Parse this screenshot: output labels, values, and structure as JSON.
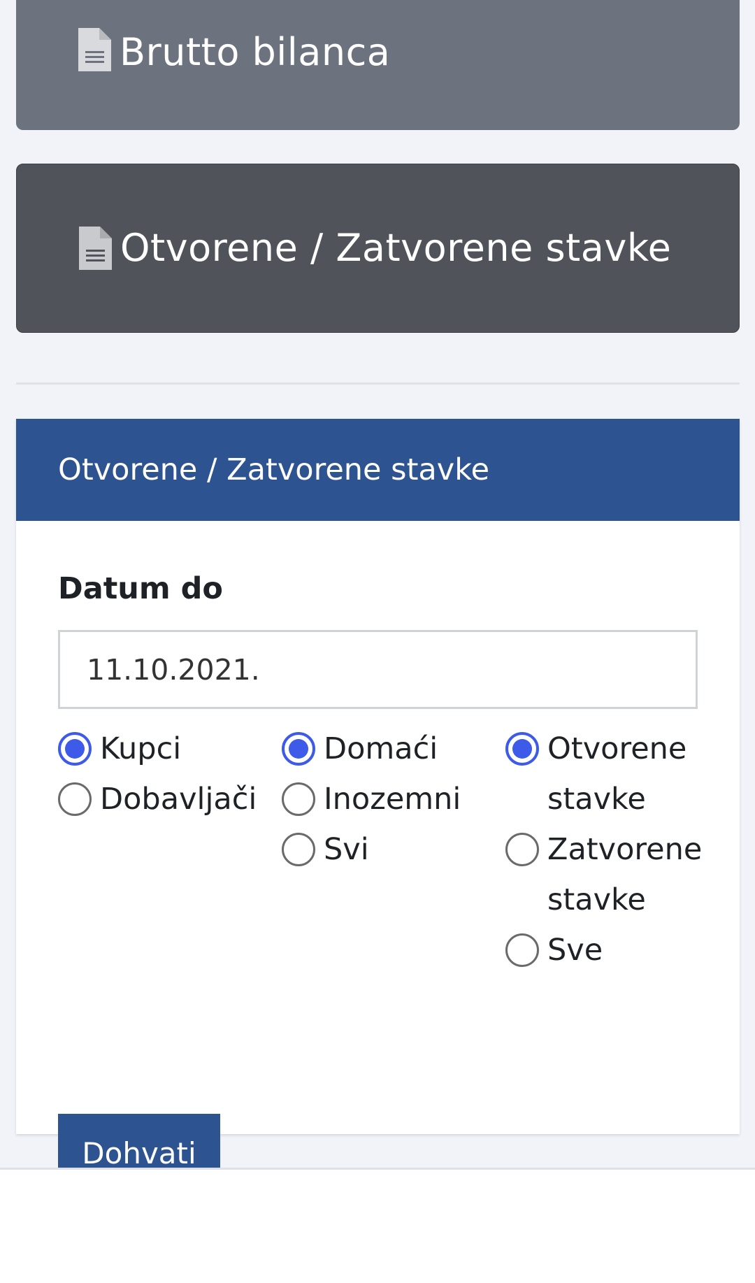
{
  "report_cards": [
    {
      "label": "Brutto bilanca",
      "icon": "document-icon"
    },
    {
      "label": "Otvorene / Zatvorene stavke",
      "icon": "document-icon"
    }
  ],
  "panel": {
    "title": "Otvorene / Zatvorene stavke",
    "date_label": "Datum do",
    "date_value": "11.10.2021.",
    "groups": [
      {
        "options": [
          {
            "label": "Kupci",
            "checked": true
          },
          {
            "label": "Dobavljači",
            "checked": false
          }
        ]
      },
      {
        "options": [
          {
            "label": "Domaći",
            "checked": true
          },
          {
            "label": "Inozemni",
            "checked": false
          },
          {
            "label": "Svi",
            "checked": false
          }
        ]
      },
      {
        "options": [
          {
            "label": "Otvorene stavke",
            "checked": true
          },
          {
            "label": "Zatvorene stavke",
            "checked": false
          },
          {
            "label": "Sve",
            "checked": false
          }
        ]
      }
    ],
    "submit_label": "Dohvati"
  },
  "colors": {
    "card_1_bg": "#6c727e",
    "card_2_bg": "#50535a",
    "panel_header_bg": "#2d5391",
    "radio_accent": "#3d5ae8",
    "page_bg": "#f2f3f8"
  }
}
